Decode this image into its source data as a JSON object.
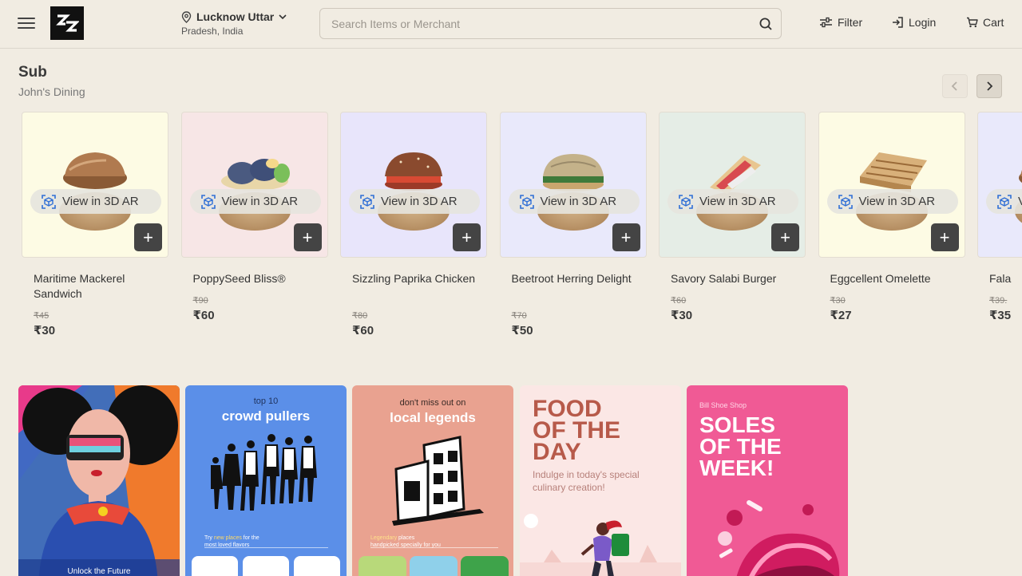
{
  "header": {
    "location_line1": "Lucknow Uttar",
    "location_line2": "Pradesh, India",
    "search_placeholder": "Search Items or Merchant",
    "filter_label": "Filter",
    "login_label": "Login",
    "cart_label": "Cart"
  },
  "section": {
    "title": "Sub",
    "subtitle": "John's Dining",
    "ar_label": "View in 3D AR",
    "items": [
      {
        "name": "Maritime Mackerel Sandwich",
        "old_price": "₹45",
        "price": "₹30",
        "bg": "#fdfbe4",
        "food": "bun"
      },
      {
        "name": "PoppySeed Bliss®",
        "old_price": "₹90",
        "price": "₹60",
        "bg": "#f7e6e6",
        "food": "roll"
      },
      {
        "name": "Sizzling Paprika Chicken",
        "old_price": "₹80",
        "price": "₹60",
        "bg": "#e8e5fb",
        "food": "burger"
      },
      {
        "name": "Beetroot Herring Delight",
        "old_price": "₹70",
        "price": "₹50",
        "bg": "#e9e9fb",
        "food": "bagel"
      },
      {
        "name": "Savory Salabi Burger",
        "old_price": "₹60",
        "price": "₹30",
        "bg": "#e5ede6",
        "food": "wrap"
      },
      {
        "name": "Eggcellent Omelette",
        "old_price": "₹30",
        "price": "₹27",
        "bg": "#fdfbe4",
        "food": "toast"
      },
      {
        "name": "Fala",
        "old_price": "₹39.",
        "price": "₹35",
        "bg": "#e9e9fb",
        "food": "bun"
      }
    ]
  },
  "banners": {
    "b1": {
      "caption": "Unlock the Future"
    },
    "b2": {
      "small": "top 10",
      "big": "crowd pullers",
      "foot_highlight": "new places",
      "foot_pre": "Try",
      "foot_post": "for the",
      "foot_line2": "most loved flavors"
    },
    "b3": {
      "small": "don't miss out on",
      "big": "local legends",
      "foot_highlight": "Legendary",
      "foot_post": "places",
      "foot_line2": "handpicked specially for you"
    },
    "b4": {
      "title_1": "FOOD",
      "title_2": "OF THE",
      "title_3": "DAY",
      "desc": "Indulge in today's special culinary creation!"
    },
    "b5": {
      "small": "Bill Shoe Shop",
      "title_1": "SOLES",
      "title_2": "OF THE",
      "title_3": "WEEK!"
    }
  }
}
